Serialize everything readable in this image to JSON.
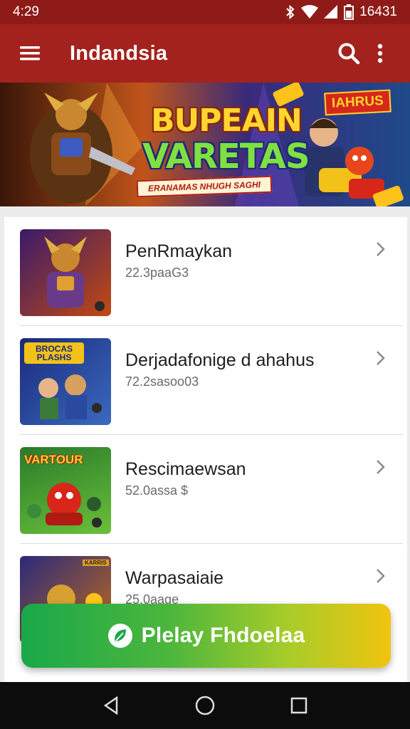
{
  "status_bar": {
    "time": "4:29",
    "battery_text": "16431"
  },
  "app_bar": {
    "title": "Indandsia"
  },
  "banner": {
    "headline_1": "BUPEAIN",
    "headline_2": "VARETAS",
    "tagline": "ERANAMAS NHUGH SAGHI",
    "badge": "IAHRUS"
  },
  "list": {
    "items": [
      {
        "name": "PenRmaykan",
        "meta": "22.3paaG3",
        "thumb_theme": "armored-warrior"
      },
      {
        "name": "Derjadafonige d ahahus",
        "meta": "72.2sasoo03",
        "thumb_theme": "heroes-group",
        "thumb_caption": "BROCAS PLASHS"
      },
      {
        "name": "Rescimaewsan",
        "meta": "52.0assa $",
        "thumb_theme": "red-creature",
        "thumb_caption": "VARTOUR"
      },
      {
        "name": "Warpasaiaie",
        "meta": "25.0aage",
        "thumb_theme": "golden-knight",
        "thumb_caption": "KARRIS"
      }
    ]
  },
  "cta": {
    "label": "Plelay Fhdoelaa"
  },
  "colors": {
    "app_bar": "#a3221d",
    "status_bar": "#8e1b17",
    "cta_start": "#1aa84a",
    "cta_end": "#f1c40f"
  }
}
